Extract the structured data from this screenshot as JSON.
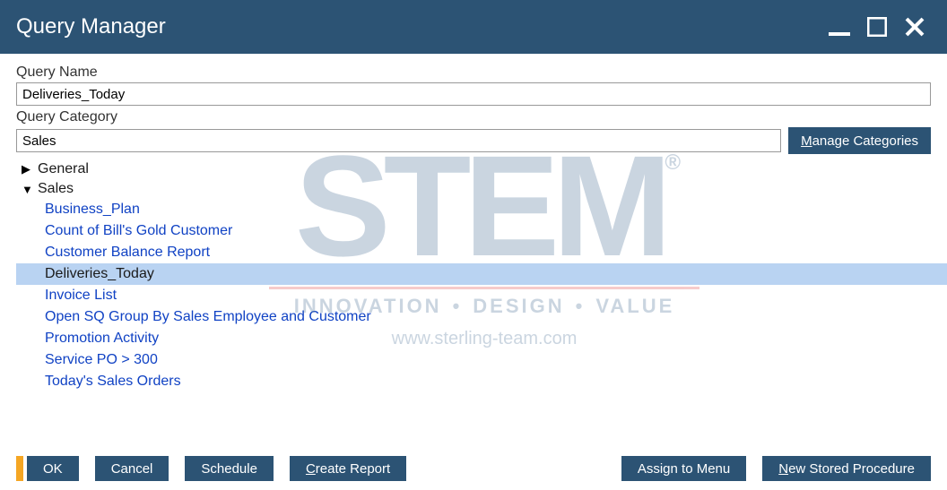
{
  "window": {
    "title": "Query Manager"
  },
  "fields": {
    "queryName_label": "Query Name",
    "queryName_value": "Deliveries_Today",
    "queryCategory_label": "Query Category",
    "queryCategory_value": "Sales"
  },
  "buttons": {
    "manageCategories_pre": "M",
    "manageCategories_rest": "anage Categories",
    "ok": "OK",
    "cancel": "Cancel",
    "schedule": "Schedule",
    "createReport_pre": "C",
    "createReport_rest": "reate Report",
    "assign_pre": "Assi",
    "assign_mn": "g",
    "assign_rest": "n to Menu",
    "newSP_pre": "N",
    "newSP_rest": "ew Stored Procedure"
  },
  "tree": {
    "nodes": [
      {
        "label": "General",
        "expanded": false
      },
      {
        "label": "Sales",
        "expanded": true,
        "children": [
          "Business_Plan",
          "Count of Bill's Gold Customer",
          "Customer Balance Report",
          "Deliveries_Today",
          "Invoice List",
          "Open SQ Group By Sales Employee and Customer",
          "Promotion Activity",
          "Service PO > 300",
          "Today's Sales Orders"
        ],
        "selected": "Deliveries_Today"
      }
    ]
  },
  "watermark": {
    "brand": "STEM",
    "tagline1": "INNOVATION",
    "tagline2": "DESIGN",
    "tagline3": "VALUE",
    "url": "www.sterling-team.com"
  }
}
